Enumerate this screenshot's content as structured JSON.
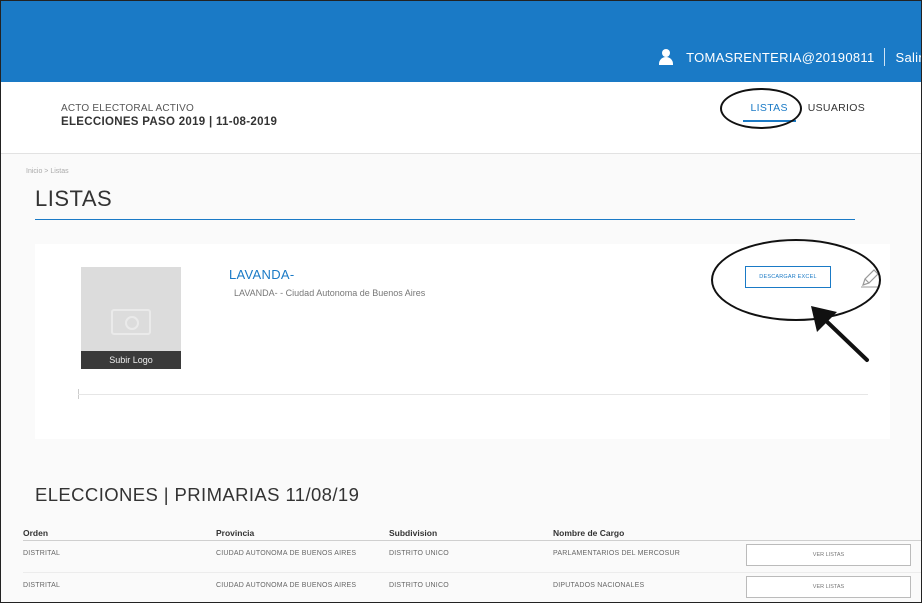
{
  "header": {
    "user": "TOMASRENTERIA@20190811",
    "logout": "Salir"
  },
  "acto": {
    "label": "ACTO ELECTORAL ACTIVO",
    "title": "ELECCIONES PASO 2019 | 11-08-2019"
  },
  "nav": {
    "tabs": [
      {
        "label": "LISTAS",
        "active": true
      },
      {
        "label": "USUARIOS",
        "active": false
      }
    ]
  },
  "breadcrumb": "Inicio > Listas",
  "page_title": "LISTAS",
  "lista": {
    "name": "LAVANDA-",
    "subtitle": "LAVANDA- - Ciudad Autonoma de Buenos Aires",
    "upload_logo": "Subir Logo",
    "download_button": "DESCARGAR EXCEL"
  },
  "section": {
    "title": "ELECCIONES | PRIMARIAS 11/08/19",
    "columns": [
      "Orden",
      "Provincia",
      "Subdivision",
      "Nombre de Cargo"
    ],
    "rows": [
      {
        "orden": "DISTRITAL",
        "provincia": "CIUDAD AUTONOMA DE BUENOS AIRES",
        "subdivision": "DISTRITO UNICO",
        "cargo": "PARLAMENTARIOS DEL MERCOSUR",
        "action": "VER LISTAS"
      },
      {
        "orden": "DISTRITAL",
        "provincia": "CIUDAD AUTONOMA DE BUENOS AIRES",
        "subdivision": "DISTRITO UNICO",
        "cargo": "DIPUTADOS NACIONALES",
        "action": "VER LISTAS"
      }
    ]
  },
  "colors": {
    "brand": "#1a7ac6",
    "annotation": "#111111"
  }
}
